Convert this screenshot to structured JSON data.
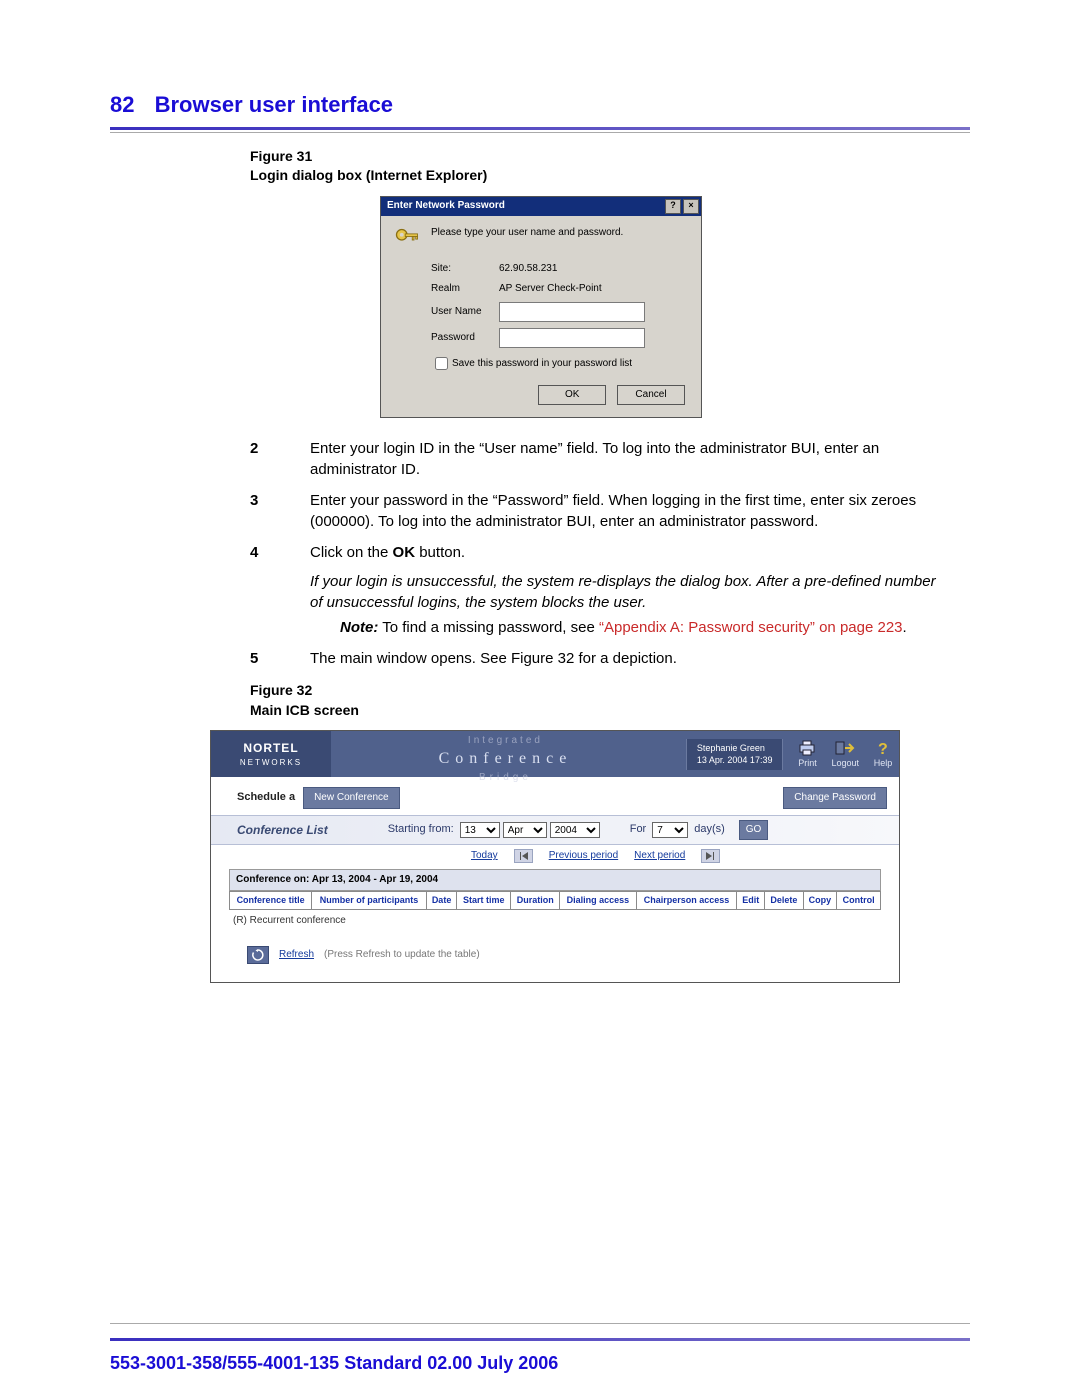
{
  "header": {
    "page_number": "82",
    "title": "Browser user interface"
  },
  "fig31": {
    "caption_line1": "Figure 31",
    "caption_line2": "Login dialog box (Internet Explorer)",
    "dialog": {
      "title": "Enter Network Password",
      "help_btn": "?",
      "close_btn": "×",
      "intro": "Please type your user name and password.",
      "site_label": "Site:",
      "site_value": "62.90.58.231",
      "realm_label": "Realm",
      "realm_value": "AP Server Check-Point",
      "user_label": "User Name",
      "pass_label": "Password",
      "save_label": "Save this password in your password list",
      "ok": "OK",
      "cancel": "Cancel"
    }
  },
  "steps": {
    "s2_num": "2",
    "s2": "Enter your login ID in the “User name” field. To log into the administrator BUI, enter an administrator ID.",
    "s3_num": "3",
    "s3": "Enter your password in the “Password” field. When logging in the first time, enter six zeroes (000000). To log into the administrator BUI, enter an administrator password.",
    "s4_num": "4",
    "s4_pre": "Click on the ",
    "s4_bold": "OK",
    "s4_post": " button.",
    "s4_italic": "If your login is unsuccessful, the system re-displays the dialog box. After a pre-defined number of unsuccessful logins, the system blocks the user.",
    "note_label": "Note:",
    "note_text": "  To find a missing password, see ",
    "note_link": "“Appendix A: Password security” on page 223",
    "note_dot": ".",
    "s5_num": "5",
    "s5": "The main window opens. See Figure 32 for a depiction."
  },
  "fig32": {
    "caption_line1": "Figure 32",
    "caption_line2": "Main ICB screen",
    "brand1": "NORTEL",
    "brand2": "NETWORKS",
    "banner_upper": "Integrated",
    "banner_mid": "Conference",
    "banner_lower": "Bridge",
    "user_name": "Stephanie Green",
    "user_time": "13 Apr. 2004 17:39",
    "act_print": "Print",
    "act_logout": "Logout",
    "act_help": "Help",
    "schedule_label": "Schedule a",
    "new_conf": "New Conference",
    "change_pw": "Change Password",
    "conf_list": "Conference List",
    "starting_from": "Starting from:",
    "sel_day": "13",
    "sel_month": "Apr",
    "sel_year": "2004",
    "for_label": "For",
    "for_days": "7",
    "days_label": "day(s)",
    "go": "GO",
    "today": "Today",
    "prev_period": "Previous period",
    "next_period": "Next period",
    "sub_title": "Conference on: Apr 13, 2004 - Apr 19, 2004",
    "cols": {
      "c1": "Conference title",
      "c2": "Number of participants",
      "c3": "Date",
      "c4": "Start time",
      "c5": "Duration",
      "c6": "Dialing access",
      "c7": "Chairperson access",
      "c8": "Edit",
      "c9": "Delete",
      "c10": "Copy",
      "c11": "Control"
    },
    "recurrent": "(R) Recurrent conference",
    "refresh": "Refresh",
    "refresh_hint": "(Press Refresh to update the table)"
  },
  "footer": "553-3001-358/555-4001-135   Standard   02.00   July 2006"
}
